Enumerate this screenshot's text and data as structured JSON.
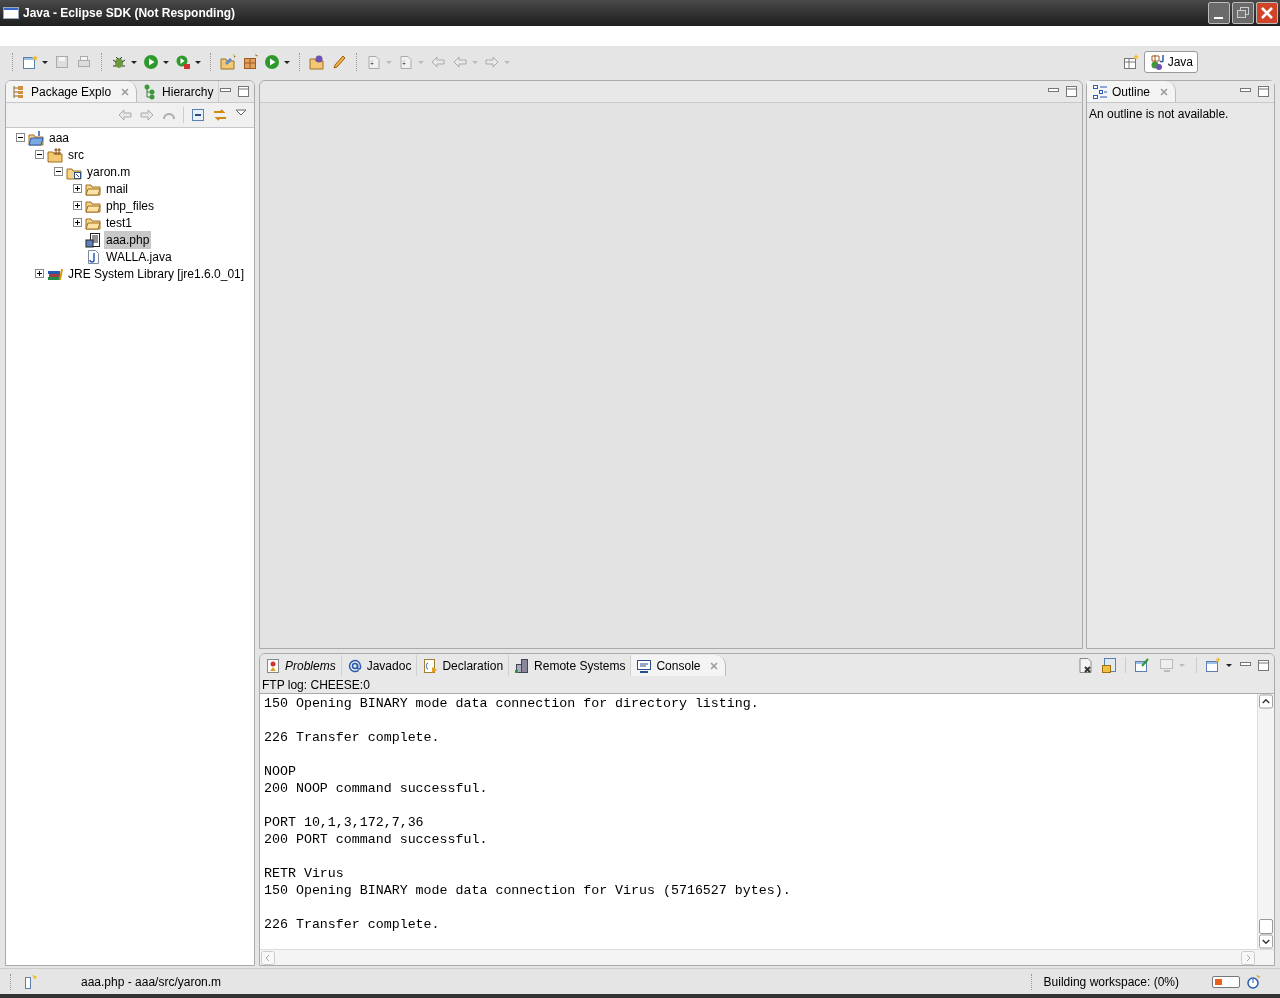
{
  "window": {
    "title": "Java - Eclipse SDK (Not Responding)"
  },
  "perspective": {
    "label": "Java",
    "selected": true
  },
  "package_explorer": {
    "tabs": [
      {
        "label": "Package Explo",
        "selected": true,
        "kind": "packages"
      },
      {
        "label": "Hierarchy",
        "selected": false,
        "kind": "hierarchy"
      }
    ],
    "tree": [
      {
        "label": "aaa",
        "kind": "project",
        "selected": false,
        "expanded": true,
        "children": [
          {
            "label": "src",
            "kind": "source-folder",
            "selected": false,
            "expanded": true,
            "children": [
              {
                "label": "yaron.m",
                "kind": "package",
                "selected": false,
                "expanded": true,
                "children": [
                  {
                    "label": "mail",
                    "kind": "folder",
                    "selected": false,
                    "expanded": false
                  },
                  {
                    "label": "php_files",
                    "kind": "folder",
                    "selected": false,
                    "expanded": false
                  },
                  {
                    "label": "test1",
                    "kind": "folder",
                    "selected": false,
                    "expanded": false
                  },
                  {
                    "label": "aaa.php",
                    "kind": "php-file",
                    "selected": true
                  },
                  {
                    "label": "WALLA.java",
                    "kind": "java-file",
                    "selected": false
                  }
                ]
              }
            ]
          },
          {
            "label": "JRE System Library [jre1.6.0_01]",
            "kind": "library",
            "selected": false,
            "expanded": false
          }
        ]
      }
    ]
  },
  "outline": {
    "tab": {
      "label": "Outline",
      "selected": true,
      "kind": "outline"
    },
    "message": "An outline is not available."
  },
  "bottom_panel": {
    "tabs": [
      {
        "label": "Problems",
        "selected": false,
        "italic": true,
        "kind": "problems"
      },
      {
        "label": "Javadoc",
        "selected": false,
        "italic": false,
        "kind": "javadoc"
      },
      {
        "label": "Declaration",
        "selected": false,
        "italic": false,
        "kind": "declaration"
      },
      {
        "label": "Remote Systems",
        "selected": false,
        "italic": false,
        "kind": "remote"
      },
      {
        "label": "Console",
        "selected": true,
        "italic": false,
        "kind": "console"
      }
    ],
    "console_title": "FTP log: CHEESE:0",
    "console_blocks": [
      [
        "150 Opening BINARY mode data connection for directory listing."
      ],
      [
        "226 Transfer complete."
      ],
      [
        "NOOP",
        "200 NOOP command successful."
      ],
      [
        "PORT 10,1,3,172,7,36",
        "200 PORT command successful."
      ],
      [
        "RETR Virus",
        "150 Opening BINARY mode data connection for Virus (5716527 bytes)."
      ],
      [
        "226 Transfer complete."
      ]
    ]
  },
  "status_bar": {
    "path": "aaa.php - aaa/src/yaron.m",
    "progress_text": "Building workspace: (0%)",
    "progress": {
      "level": 0.3
    }
  }
}
